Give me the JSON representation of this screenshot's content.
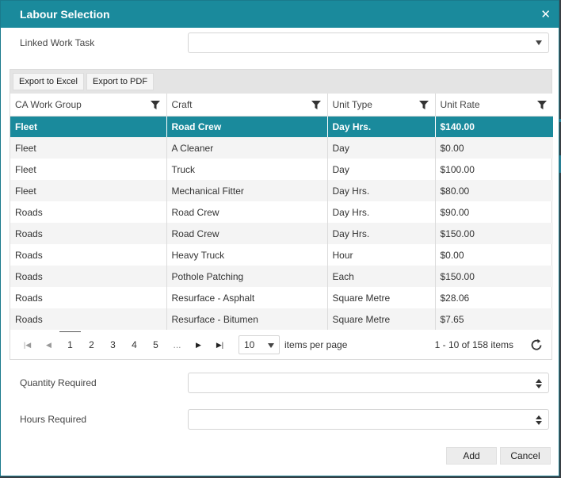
{
  "dialog": {
    "title": "Labour Selection",
    "close_glyph": "✕"
  },
  "linked_work_task": {
    "label": "Linked Work Task",
    "value": ""
  },
  "toolbar": {
    "export_excel_label": "Export to Excel",
    "export_pdf_label": "Export to PDF"
  },
  "table": {
    "columns": [
      "CA Work Group",
      "Craft",
      "Unit Type",
      "Unit Rate"
    ],
    "rows": [
      [
        "Fleet",
        "Road Crew",
        "Day Hrs.",
        "$140.00"
      ],
      [
        "Fleet",
        "A Cleaner",
        "Day",
        "$0.00"
      ],
      [
        "Fleet",
        "Truck",
        "Day",
        "$100.00"
      ],
      [
        "Fleet",
        "Mechanical Fitter",
        "Day Hrs.",
        "$80.00"
      ],
      [
        "Roads",
        "Road Crew",
        "Day Hrs.",
        "$90.00"
      ],
      [
        "Roads",
        "Road Crew",
        "Day Hrs.",
        "$150.00"
      ],
      [
        "Roads",
        "Heavy Truck",
        "Hour",
        "$0.00"
      ],
      [
        "Roads",
        "Pothole Patching",
        "Each",
        "$150.00"
      ],
      [
        "Roads",
        "Resurface - Asphalt",
        "Square Metre",
        "$28.06"
      ],
      [
        "Roads",
        "Resurface - Bitumen",
        "Square Metre",
        "$7.65"
      ]
    ],
    "selected_row": 0
  },
  "pager": {
    "pages": [
      "1",
      "2",
      "3",
      "4",
      "5",
      "..."
    ],
    "current_page": "1",
    "page_size": "10",
    "items_per_page_label": "items per page",
    "info": "1 - 10 of 158 items"
  },
  "quantity": {
    "label": "Quantity Required",
    "value": ""
  },
  "hours": {
    "label": "Hours Required",
    "value": ""
  },
  "actions": {
    "add_label": "Add",
    "cancel_label": "Cancel"
  },
  "colors": {
    "accent": "#1a8a9c",
    "selected_row_bg": "#1a8a9c"
  }
}
